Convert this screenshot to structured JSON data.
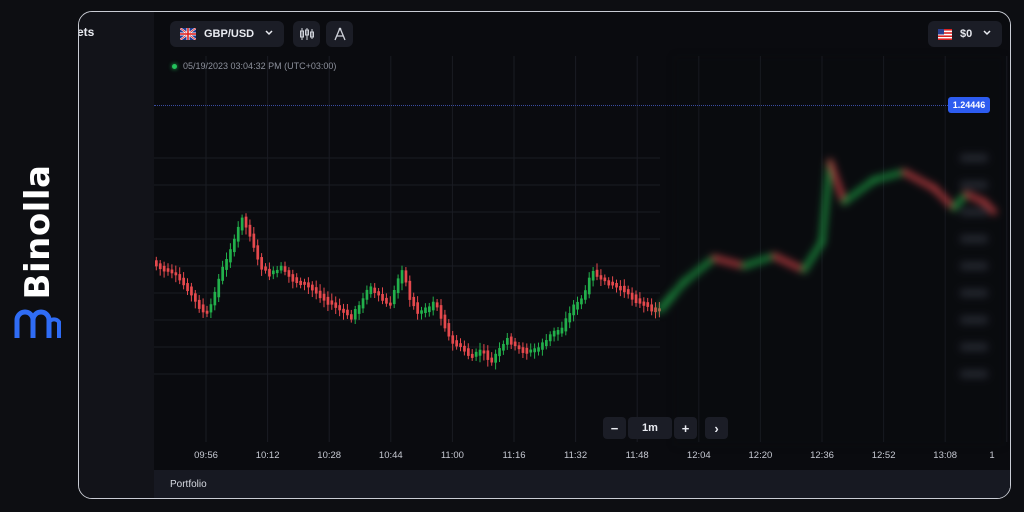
{
  "brand": {
    "name": "Binolla"
  },
  "sidebar": {
    "label": "ets"
  },
  "toolbar": {
    "pair": "GBP/USD",
    "chart_type_icon": "candlestick-icon",
    "drawing_icon": "compass-icon",
    "balance": "$0"
  },
  "chart": {
    "timestamp": "05/19/2023  03:04:32 PM  (UTC+03:00)",
    "current_price": "1.24446",
    "time_labels": [
      "09:56",
      "10:12",
      "10:28",
      "10:44",
      "11:00",
      "11:16",
      "11:32",
      "11:48",
      "12:04",
      "12:20",
      "12:36",
      "12:52",
      "13:08",
      "1"
    ],
    "colors": {
      "up": "#22b04b",
      "down": "#e5494d",
      "price": "#2d5cf0"
    }
  },
  "zoom": {
    "minus": "−",
    "interval": "1m",
    "plus": "+",
    "next": "›"
  },
  "footer": {
    "portfolio": "Portfolio"
  }
}
